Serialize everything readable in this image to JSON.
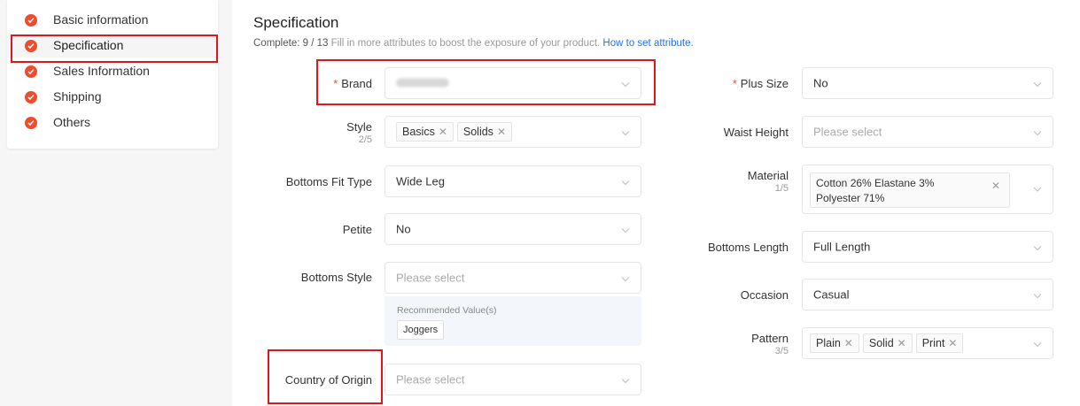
{
  "sidebar": {
    "items": [
      {
        "label": "Basic information"
      },
      {
        "label": "Specification"
      },
      {
        "label": "Sales Information"
      },
      {
        "label": "Shipping"
      },
      {
        "label": "Others"
      }
    ]
  },
  "header": {
    "title": "Specification",
    "complete_label": "Complete: 9 / 13",
    "hint": " Fill in more attributes to boost the exposure of your product. ",
    "link": "How to set attribute."
  },
  "left_fields": {
    "brand": {
      "label": "Brand",
      "required": "*"
    },
    "style": {
      "label": "Style",
      "count": "2/5",
      "tags": [
        "Basics",
        "Solids"
      ]
    },
    "bottoms_fit": {
      "label": "Bottoms Fit Type",
      "value": "Wide Leg"
    },
    "petite": {
      "label": "Petite",
      "value": "No"
    },
    "bottoms_style": {
      "label": "Bottoms Style",
      "placeholder": "Please select",
      "recommended_title": "Recommended Value(s)",
      "recommended": "Joggers"
    },
    "country": {
      "label": "Country of Origin",
      "placeholder": "Please select"
    }
  },
  "right_fields": {
    "plus_size": {
      "label": "Plus Size",
      "required": "*",
      "value": "No"
    },
    "waist_height": {
      "label": "Waist Height",
      "placeholder": "Please select"
    },
    "material": {
      "label": "Material",
      "count": "1/5",
      "line1": "Cotton 26% Elastane 3%",
      "line2": "Polyester 71%"
    },
    "bottoms_length": {
      "label": "Bottoms Length",
      "value": "Full Length"
    },
    "occasion": {
      "label": "Occasion",
      "value": "Casual"
    },
    "pattern": {
      "label": "Pattern",
      "count": "3/5",
      "tags": [
        "Plain",
        "Solid",
        "Print"
      ]
    }
  },
  "colors": {
    "accent": "#ee4d2d",
    "link": "#2673dd",
    "highlight": "#e0161d"
  }
}
